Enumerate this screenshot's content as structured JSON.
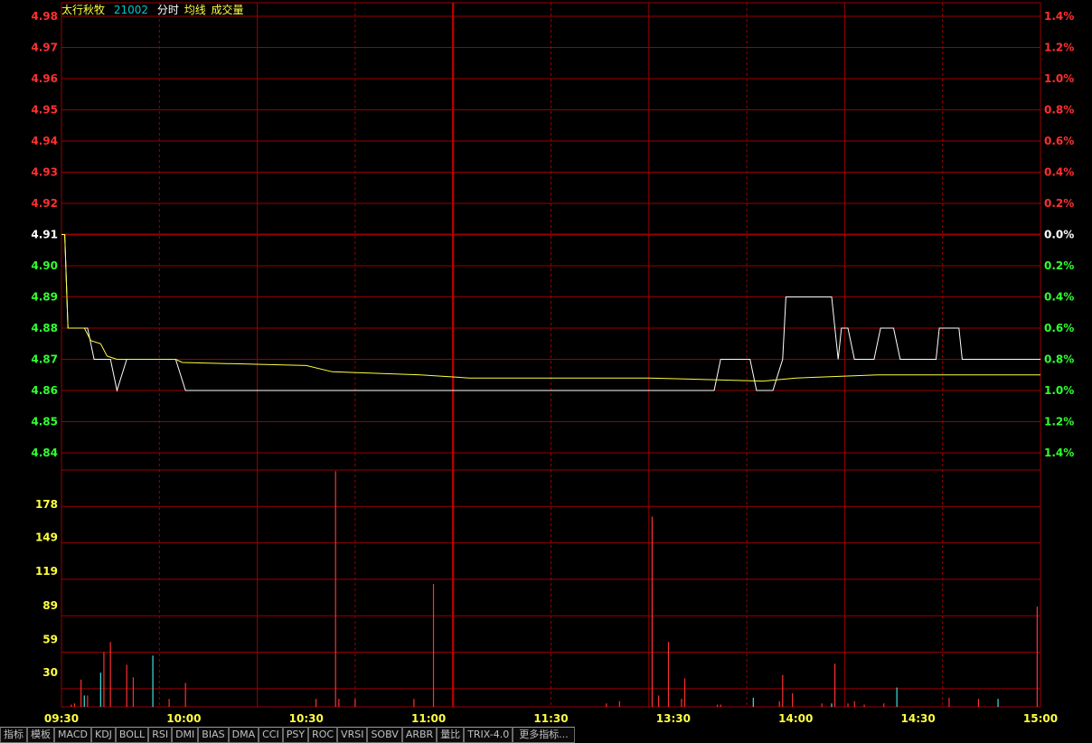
{
  "header": {
    "stock_name": "太行秋牧",
    "stock_code": "21002",
    "label_minute": "分时",
    "label_avg": "均线",
    "label_volume": "成交量",
    "colors": {
      "name": "#ffff40",
      "code": "#00c8c8",
      "minute": "#ffffff",
      "avg": "#ffff40",
      "volume": "#ffff40"
    }
  },
  "chart_data": [
    {
      "type": "line",
      "title": "",
      "x_ticks": [
        "09:30",
        "10:00",
        "10:30",
        "11:00",
        "11:30",
        "13:30",
        "14:00",
        "14:30",
        "15:00"
      ],
      "y_ticks": [
        "4.98",
        "4.97",
        "4.96",
        "4.95",
        "4.94",
        "4.93",
        "4.92",
        "4.91",
        "4.90",
        "4.89",
        "4.88",
        "4.87",
        "4.86",
        "4.85",
        "4.84"
      ],
      "pct_ticks": [
        "1.4%",
        "1.2%",
        "1.0%",
        "0.8%",
        "0.6%",
        "0.4%",
        "0.2%",
        "0.0%",
        "0.2%",
        "0.4%",
        "0.6%",
        "0.8%",
        "1.0%",
        "1.2%",
        "1.4%"
      ],
      "ylim": [
        4.84,
        4.98
      ],
      "prev_close": 4.91,
      "series": [
        {
          "name": "分时",
          "color": "#ffffff",
          "points": [
            [
              0,
              4.91
            ],
            [
              1,
              4.91
            ],
            [
              2,
              4.88
            ],
            [
              8,
              4.88
            ],
            [
              10,
              4.87
            ],
            [
              15,
              4.87
            ],
            [
              17,
              4.86
            ],
            [
              20,
              4.87
            ],
            [
              35,
              4.87
            ],
            [
              38,
              4.86
            ],
            [
              80,
              4.86
            ],
            [
              200,
              4.86
            ],
            [
              202,
              4.87
            ],
            [
              211,
              4.87
            ],
            [
              213,
              4.86
            ],
            [
              218,
              4.86
            ],
            [
              221,
              4.87
            ],
            [
              222,
              4.89
            ],
            [
              236,
              4.89
            ],
            [
              238,
              4.87
            ],
            [
              239,
              4.88
            ],
            [
              241,
              4.88
            ],
            [
              243,
              4.87
            ],
            [
              249,
              4.87
            ],
            [
              251,
              4.88
            ],
            [
              255,
              4.88
            ],
            [
              257,
              4.87
            ],
            [
              268,
              4.87
            ],
            [
              269,
              4.88
            ],
            [
              275,
              4.88
            ],
            [
              276,
              4.87
            ],
            [
              300,
              4.87
            ]
          ]
        },
        {
          "name": "均线",
          "color": "#ffff40",
          "points": [
            [
              0,
              4.91
            ],
            [
              1,
              4.91
            ],
            [
              2,
              4.88
            ],
            [
              7,
              4.88
            ],
            [
              9,
              4.876
            ],
            [
              12,
              4.875
            ],
            [
              14,
              4.871
            ],
            [
              17,
              4.87
            ],
            [
              35,
              4.87
            ],
            [
              37,
              4.869
            ],
            [
              75,
              4.868
            ],
            [
              83,
              4.866
            ],
            [
              110,
              4.865
            ],
            [
              125,
              4.864
            ],
            [
              180,
              4.864
            ],
            [
              215,
              4.863
            ],
            [
              225,
              4.864
            ],
            [
              250,
              4.865
            ],
            [
              290,
              4.865
            ],
            [
              300,
              4.865
            ]
          ]
        }
      ]
    },
    {
      "type": "bar",
      "title": "",
      "y_ticks": [
        "178",
        "149",
        "119",
        "89",
        "59",
        "30"
      ],
      "ylim": [
        0,
        208
      ],
      "bars": [
        {
          "x": 3,
          "v": 2,
          "c": "red"
        },
        {
          "x": 4,
          "v": 3,
          "c": "red"
        },
        {
          "x": 6,
          "v": 24,
          "c": "red"
        },
        {
          "x": 7,
          "v": 10,
          "c": "cyan"
        },
        {
          "x": 8,
          "v": 10,
          "c": "red"
        },
        {
          "x": 12,
          "v": 30,
          "c": "cyan"
        },
        {
          "x": 13,
          "v": 48,
          "c": "red"
        },
        {
          "x": 15,
          "v": 57,
          "c": "red"
        },
        {
          "x": 20,
          "v": 37,
          "c": "red"
        },
        {
          "x": 22,
          "v": 26,
          "c": "red"
        },
        {
          "x": 28,
          "v": 45,
          "c": "cyan"
        },
        {
          "x": 33,
          "v": 7,
          "c": "red"
        },
        {
          "x": 38,
          "v": 21,
          "c": "red"
        },
        {
          "x": 78,
          "v": 7,
          "c": "red"
        },
        {
          "x": 84,
          "v": 207,
          "c": "red"
        },
        {
          "x": 85,
          "v": 7,
          "c": "red"
        },
        {
          "x": 90,
          "v": 7,
          "c": "red"
        },
        {
          "x": 108,
          "v": 7,
          "c": "red"
        },
        {
          "x": 114,
          "v": 108,
          "c": "red"
        },
        {
          "x": 167,
          "v": 3,
          "c": "red"
        },
        {
          "x": 171,
          "v": 5,
          "c": "red"
        },
        {
          "x": 181,
          "v": 167,
          "c": "red"
        },
        {
          "x": 183,
          "v": 10,
          "c": "red"
        },
        {
          "x": 186,
          "v": 57,
          "c": "red"
        },
        {
          "x": 190,
          "v": 7,
          "c": "red"
        },
        {
          "x": 191,
          "v": 25,
          "c": "red"
        },
        {
          "x": 201,
          "v": 2,
          "c": "red"
        },
        {
          "x": 202,
          "v": 2,
          "c": "red"
        },
        {
          "x": 212,
          "v": 8,
          "c": "cyan"
        },
        {
          "x": 220,
          "v": 5,
          "c": "red"
        },
        {
          "x": 221,
          "v": 28,
          "c": "red"
        },
        {
          "x": 224,
          "v": 12,
          "c": "red"
        },
        {
          "x": 233,
          "v": 3,
          "c": "red"
        },
        {
          "x": 236,
          "v": 3,
          "c": "cyan"
        },
        {
          "x": 237,
          "v": 38,
          "c": "red"
        },
        {
          "x": 241,
          "v": 3,
          "c": "red"
        },
        {
          "x": 243,
          "v": 5,
          "c": "red"
        },
        {
          "x": 246,
          "v": 2,
          "c": "red"
        },
        {
          "x": 252,
          "v": 3,
          "c": "red"
        },
        {
          "x": 256,
          "v": 17,
          "c": "cyan"
        },
        {
          "x": 272,
          "v": 8,
          "c": "red"
        },
        {
          "x": 281,
          "v": 7,
          "c": "red"
        },
        {
          "x": 287,
          "v": 7,
          "c": "cyan"
        },
        {
          "x": 299,
          "v": 88,
          "c": "red"
        }
      ]
    }
  ],
  "tabs": [
    "指标",
    "模板",
    "MACD",
    "KDJ",
    "BOLL",
    "RSI",
    "DMI",
    "BIAS",
    "DMA",
    "CCI",
    "PSY",
    "ROC",
    "VRSI",
    "SOBV",
    "ARBR",
    "量比",
    "TRIX-4.0",
    "更多指标..."
  ]
}
